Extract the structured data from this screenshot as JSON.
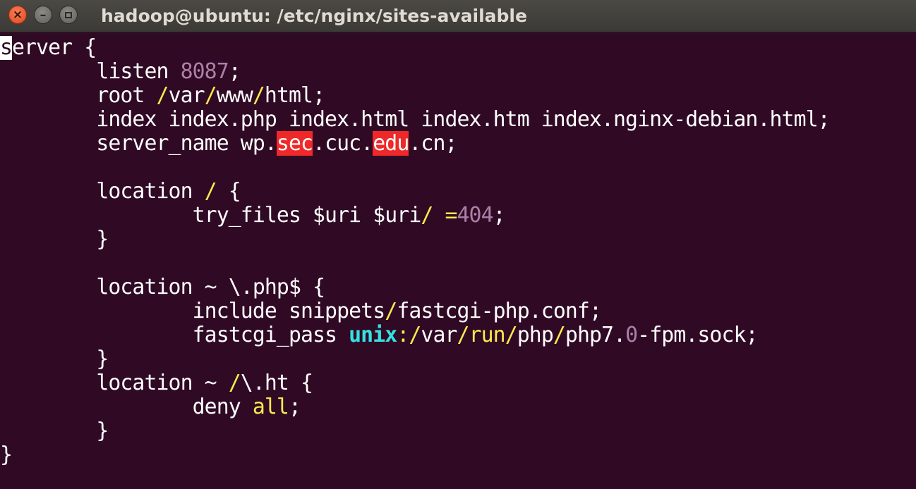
{
  "window": {
    "title": "hadoop@ubuntu: /etc/nginx/sites-available",
    "close_label": "×",
    "minimize_label": "–"
  },
  "colors": {
    "background": "#300a24",
    "text": "#ffffff",
    "number": "#ad7fa8",
    "path_separator": "#fce94f",
    "search_highlight": "#ef2929",
    "keyword_cyan": "#34e2e2"
  },
  "editor": {
    "lines": [
      {
        "segments": [
          {
            "text": "s",
            "style": "cursor"
          },
          {
            "text": "erver {"
          }
        ]
      },
      {
        "segments": [
          {
            "text": "        listen "
          },
          {
            "text": "8087",
            "style": "num"
          },
          {
            "text": ";"
          }
        ]
      },
      {
        "segments": [
          {
            "text": "        root "
          },
          {
            "text": "/",
            "style": "slash"
          },
          {
            "text": "var"
          },
          {
            "text": "/",
            "style": "slash"
          },
          {
            "text": "www"
          },
          {
            "text": "/",
            "style": "slash"
          },
          {
            "text": "html;"
          }
        ]
      },
      {
        "segments": [
          {
            "text": "        index index.php index.html index.htm index.nginx-debian.html;"
          }
        ]
      },
      {
        "segments": [
          {
            "text": "        server_name wp."
          },
          {
            "text": "sec",
            "style": "hl"
          },
          {
            "text": ".cuc."
          },
          {
            "text": "edu",
            "style": "hl"
          },
          {
            "text": ".cn;"
          }
        ]
      },
      {
        "segments": []
      },
      {
        "segments": [
          {
            "text": "        location "
          },
          {
            "text": "/",
            "style": "slash"
          },
          {
            "text": " {"
          }
        ]
      },
      {
        "segments": [
          {
            "text": "                try_files $uri $uri"
          },
          {
            "text": "/",
            "style": "slash"
          },
          {
            "text": " "
          },
          {
            "text": "=",
            "style": "yellow"
          },
          {
            "text": "404",
            "style": "num"
          },
          {
            "text": ";"
          }
        ]
      },
      {
        "segments": [
          {
            "text": "        }"
          }
        ]
      },
      {
        "segments": []
      },
      {
        "segments": [
          {
            "text": "        location ~ \\.php$ {"
          }
        ]
      },
      {
        "segments": [
          {
            "text": "                include snippets"
          },
          {
            "text": "/",
            "style": "slash"
          },
          {
            "text": "fastcgi-php.conf;"
          }
        ]
      },
      {
        "segments": [
          {
            "text": "                fastcgi_pass "
          },
          {
            "text": "unix",
            "style": "unix"
          },
          {
            "text": ":",
            "style": "yellow"
          },
          {
            "text": "/",
            "style": "slash"
          },
          {
            "text": "var"
          },
          {
            "text": "/",
            "style": "slash"
          },
          {
            "text": "run",
            "style": "yellow"
          },
          {
            "text": "/",
            "style": "slash"
          },
          {
            "text": "php"
          },
          {
            "text": "/",
            "style": "slash"
          },
          {
            "text": "php7."
          },
          {
            "text": "0",
            "style": "num"
          },
          {
            "text": "-fpm.sock;"
          }
        ]
      },
      {
        "segments": [
          {
            "text": "        }"
          }
        ]
      },
      {
        "segments": [
          {
            "text": "        location ~ "
          },
          {
            "text": "/",
            "style": "slash"
          },
          {
            "text": "\\.ht {"
          }
        ]
      },
      {
        "segments": [
          {
            "text": "                deny "
          },
          {
            "text": "all",
            "style": "yellow"
          },
          {
            "text": ";"
          }
        ]
      },
      {
        "segments": [
          {
            "text": "        }"
          }
        ]
      },
      {
        "segments": [
          {
            "text": "}"
          }
        ]
      }
    ]
  }
}
